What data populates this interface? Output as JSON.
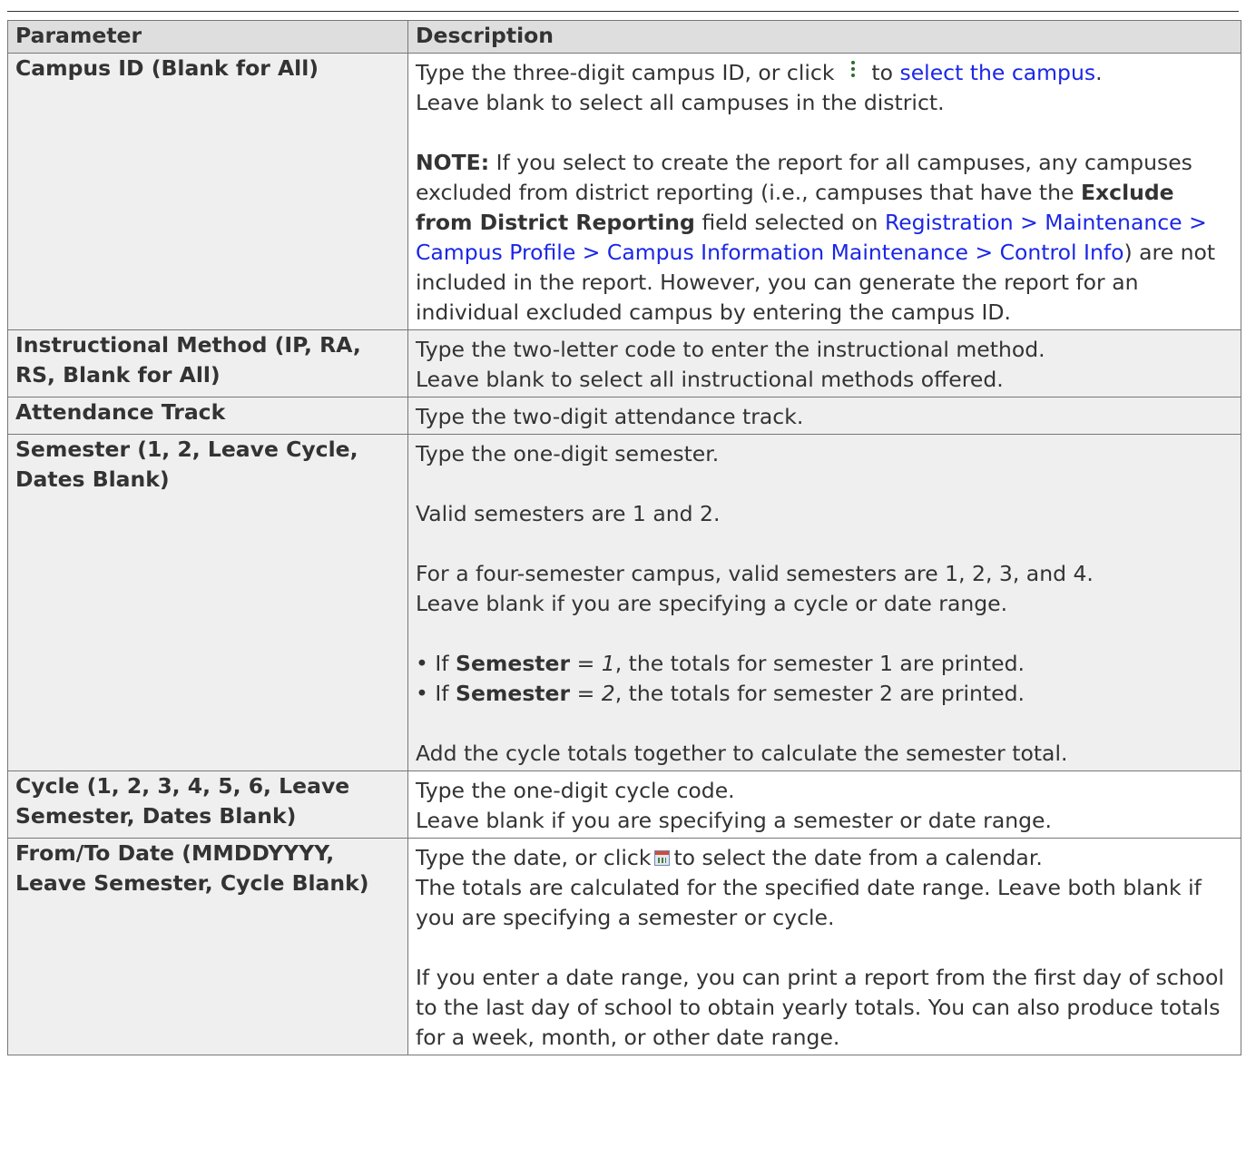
{
  "headers": {
    "parameter": "Parameter",
    "description": "Description"
  },
  "rows": {
    "campus": {
      "param": "Campus ID (Blank for All)",
      "p1_a": "Type the three-digit campus ID, or click",
      "p1_b": "to",
      "p1_link": "select the campus",
      "p1_c": ".",
      "p2": "Leave blank to select all campuses in the district.",
      "note_label": "NOTE:",
      "note_a": "If you select to create the report for all campuses, any campuses excluded from district reporting (i.e., campuses that have the",
      "note_bold": "Exclude from District Reporting",
      "note_b": "field selected on",
      "note_link": "Registration > Maintenance > Campus Profile > Campus Information Maintenance > Control Info",
      "note_c": ") are not included in the report. However, you can generate the report for an individual excluded campus by entering the campus ID."
    },
    "method": {
      "param": "Instructional Method (IP, RA, RS, Blank for All)",
      "line1": "Type the two-letter code to enter the instructional method.",
      "line2": "Leave blank to select all instructional methods offered."
    },
    "track": {
      "param": "Attendance Track",
      "line1": "Type the two-digit attendance track."
    },
    "semester": {
      "param": "Semester (1, 2, Leave Cycle, Dates Blank)",
      "line1": "Type the one-digit semester.",
      "line2": "Valid semesters are 1 and 2.",
      "line3": "For a four-semester campus, valid semesters are 1, 2, 3, and 4.",
      "line4": "Leave blank if you are specifying a cycle or date range.",
      "b1_pre": "• If",
      "b1_bold": "Semester",
      "b1_eq": "=",
      "b1_val": "1",
      "b1_post": ", the totals for semester 1 are printed.",
      "b2_pre": "• If",
      "b2_bold": "Semester",
      "b2_eq": "=",
      "b2_val": "2",
      "b2_post": ", the totals for semester 2 are printed.",
      "line5": "Add the cycle totals together to calculate the semester total."
    },
    "cycle": {
      "param": "Cycle (1, 2, 3, 4, 5, 6, Leave Semester, Dates Blank)",
      "line1": "Type the one-digit cycle code.",
      "line2": "Leave blank if you are specifying a semester or date range."
    },
    "dates": {
      "param": "From/To Date (MMDDYYYY, Leave Semester, Cycle Blank)",
      "p1_a": "Type the date, or click",
      "p1_b": "to select the date from a calendar.",
      "p2": "The totals are calculated for the specified date range. Leave both blank if you are specifying a semester or cycle.",
      "p3": "If you enter a date range, you can print a report from the first day of school to the last day of school to obtain yearly totals. You can also produce totals for a week, month, or other date range."
    }
  },
  "icons": {
    "dots": "vertical-dots-icon",
    "calendar": "calendar-icon"
  },
  "colors": {
    "link": "#1a26e6",
    "header_bg": "#dedede",
    "param_bg": "#efefef"
  }
}
